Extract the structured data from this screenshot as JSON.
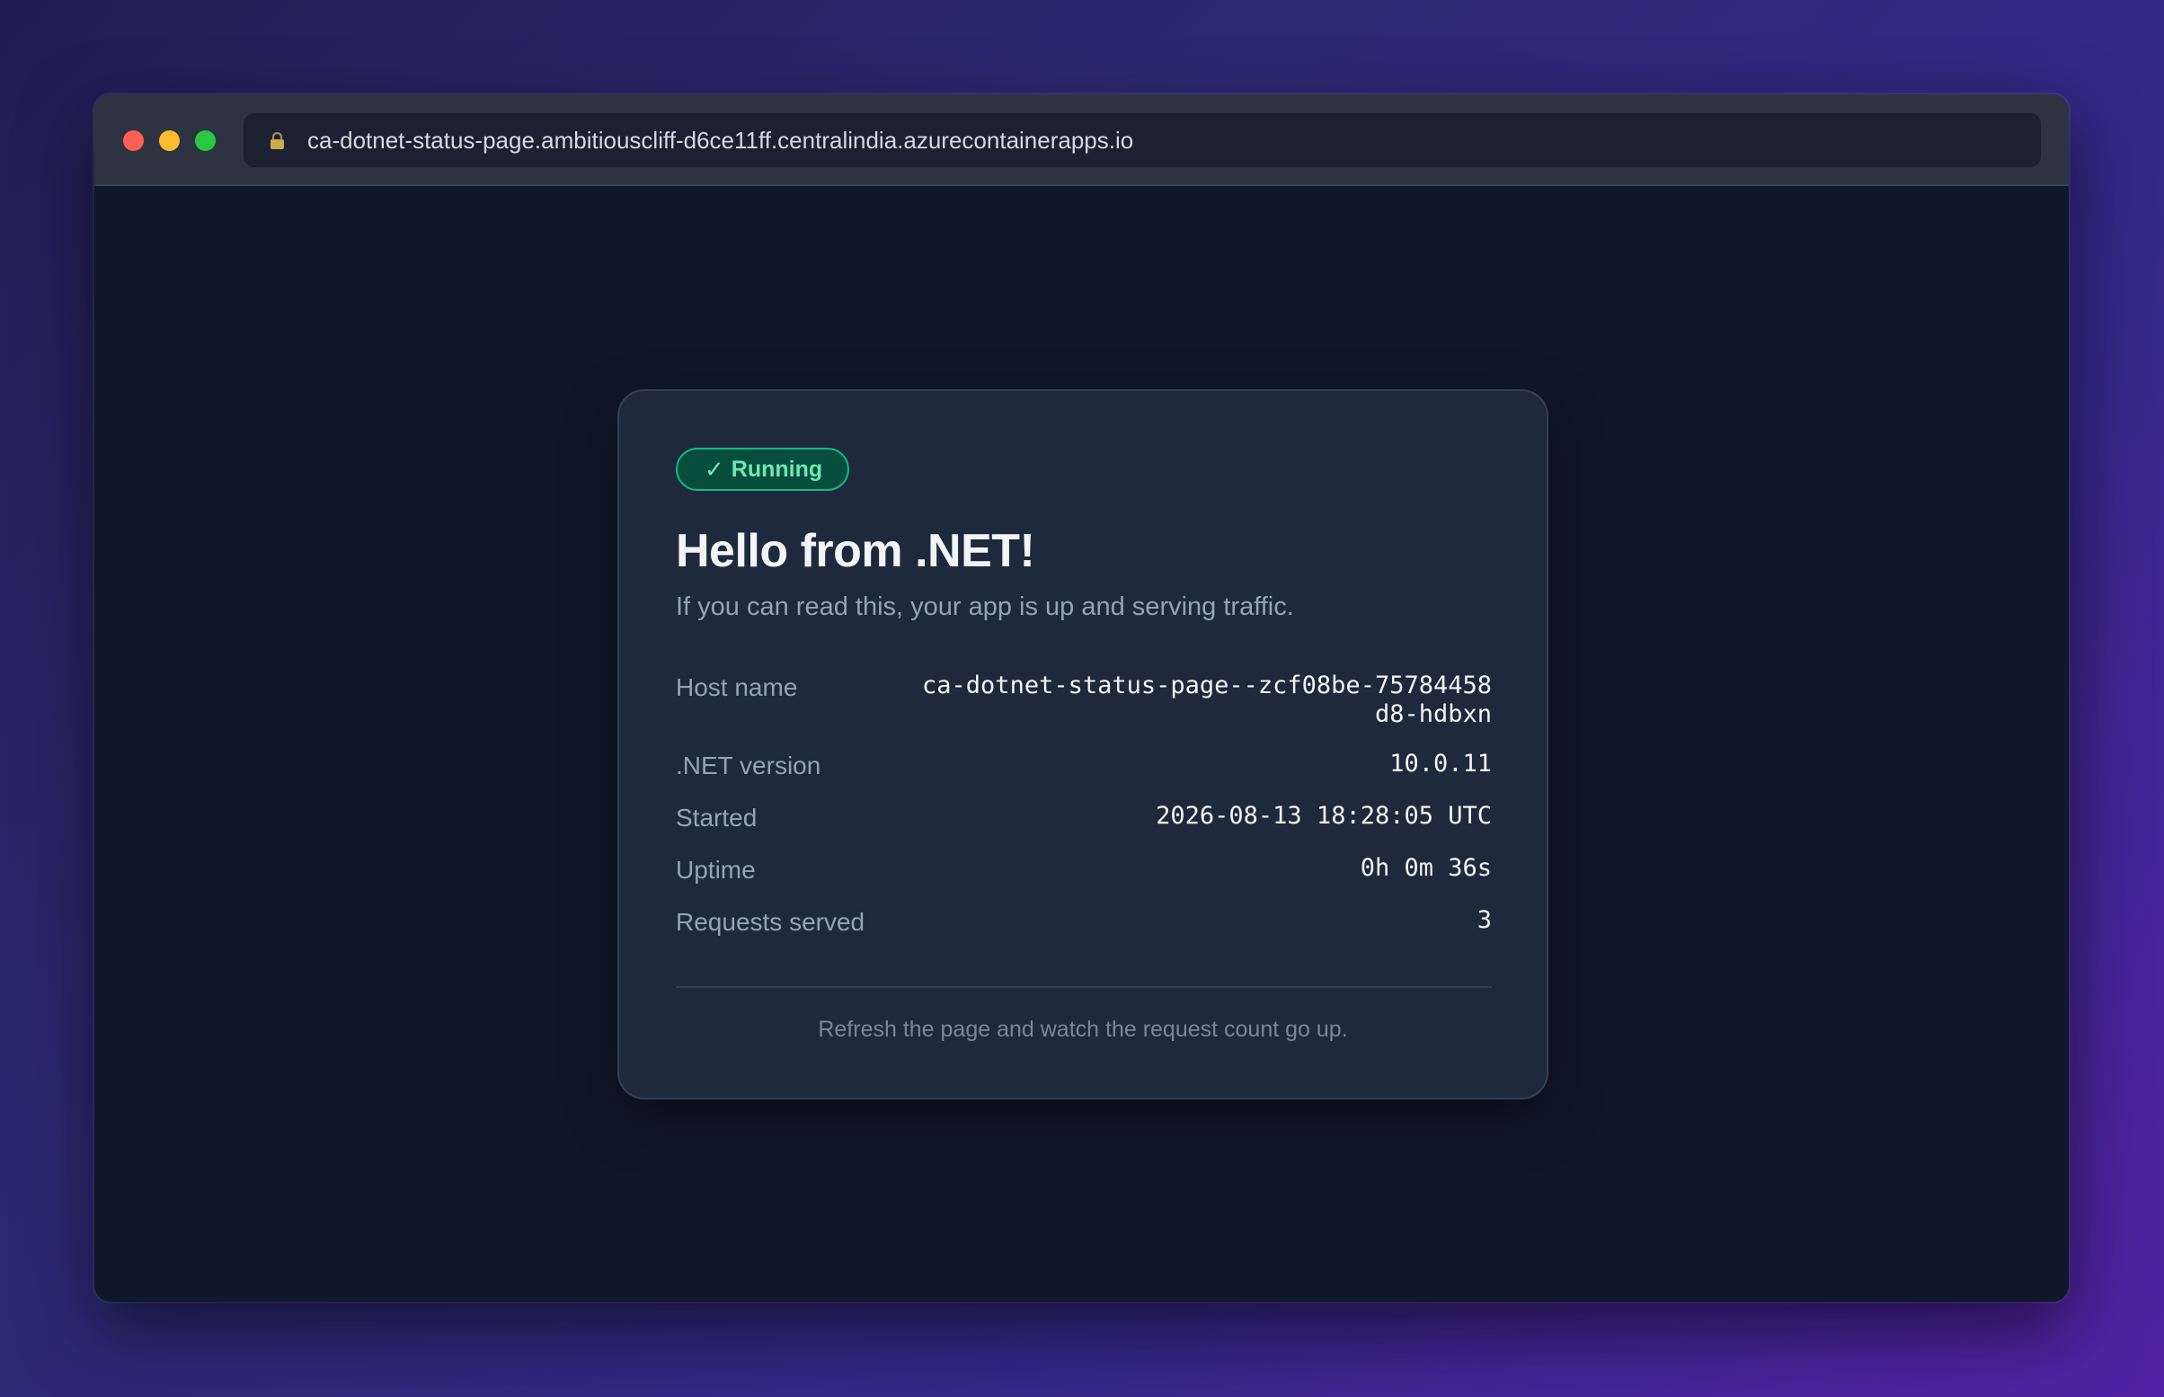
{
  "browser": {
    "url": "ca-dotnet-status-page.ambitiouscliff-d6ce11ff.centralindia.azurecontainerapps.io"
  },
  "card": {
    "status_badge": "Running",
    "status_icon": "checkmark-icon",
    "title": "Hello from .NET!",
    "subtitle": "If you can read this, your app is up and serving traffic.",
    "info": [
      {
        "label": "Host name",
        "value": "ca-dotnet-status-page--zcf08be-75784458d8-hdbxn"
      },
      {
        "label": ".NET version",
        "value": "10.0.11"
      },
      {
        "label": "Started",
        "value": "2026-08-13 18:28:05 UTC"
      },
      {
        "label": "Uptime",
        "value": "0h 0m 36s"
      },
      {
        "label": "Requests served",
        "value": "3"
      }
    ],
    "footer": "Refresh the page and watch the request count go up."
  },
  "colors": {
    "window_dot_close": "#ff5f57",
    "window_dot_minimize": "#febc2e",
    "window_dot_maximize": "#28c840",
    "badge_accent": "#10b981",
    "card_background": "#1e293b"
  }
}
